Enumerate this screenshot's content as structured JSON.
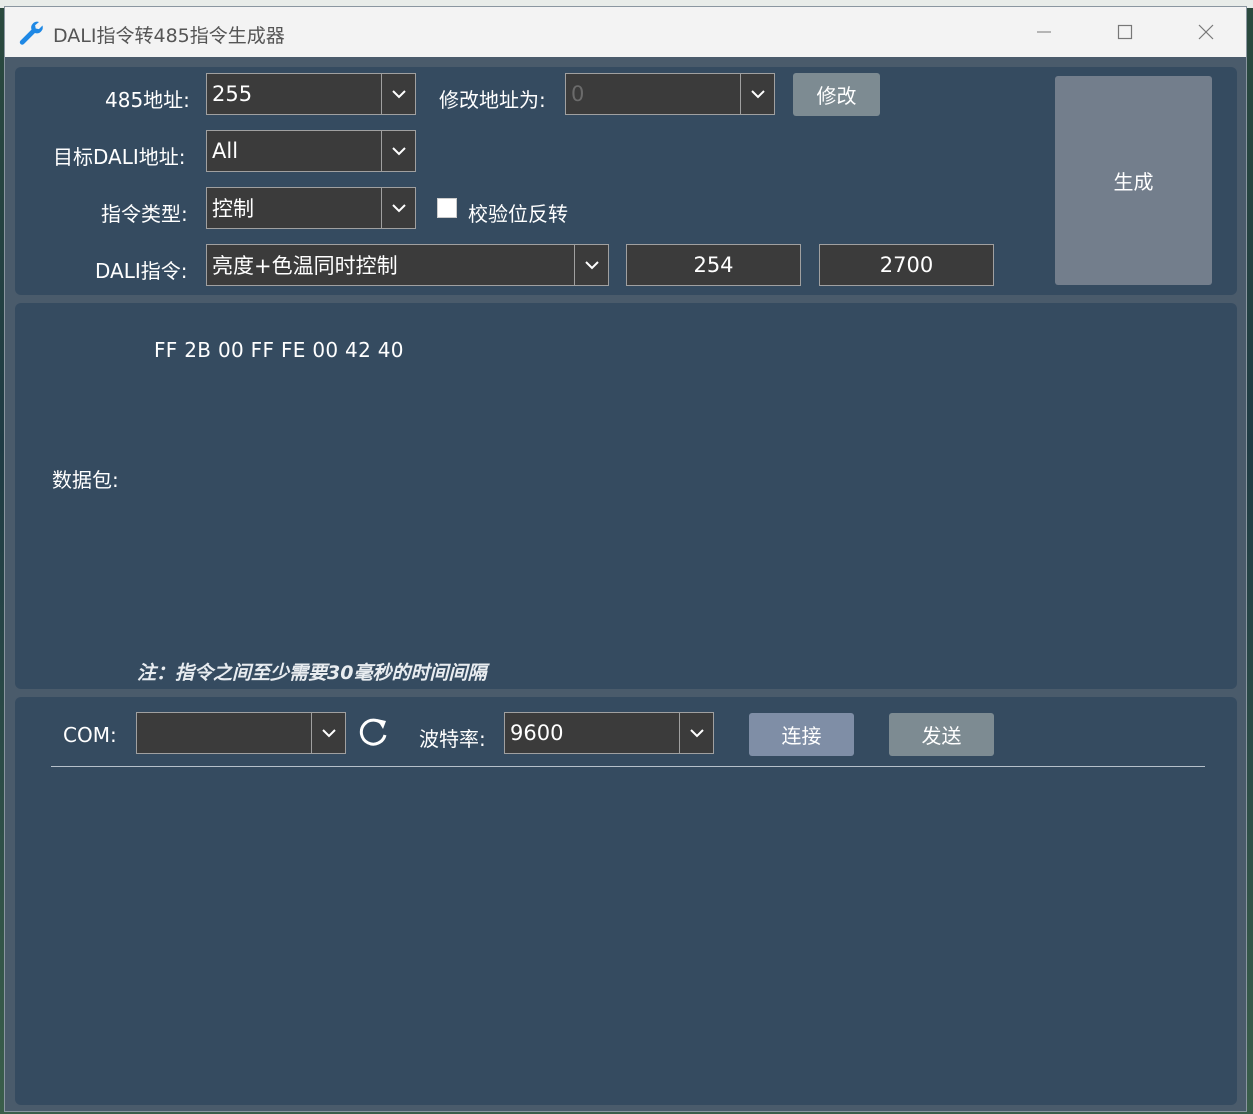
{
  "window": {
    "title": "DALI指令转485指令生成器",
    "controls": {
      "minimize": "—",
      "maximize": "☐",
      "close": "✕"
    },
    "icon": "wrench-icon"
  },
  "config": {
    "addr_label": "485地址:",
    "addr_value": "255",
    "modify_label": "修改地址为:",
    "modify_value": "0",
    "modify_button": "修改",
    "target_label": "目标DALI地址:",
    "target_value": "All",
    "type_label": "指令类型:",
    "type_value": "控制",
    "checksum_label": "校验位反转",
    "checksum_checked": false,
    "dali_label": "DALI指令:",
    "dali_value": "亮度+色温同时控制",
    "brightness": "254",
    "color_temp": "2700",
    "generate_button": "生成"
  },
  "packet": {
    "label": "数据包:",
    "hex": "FF 2B 00 FF FE 00 42 40",
    "note": "注：指令之间至少需要30毫秒的时间间隔"
  },
  "serial": {
    "com_label": "COM:",
    "com_value": "",
    "refresh_icon": "refresh-icon",
    "baud_label": "波特率:",
    "baud_value": "9600",
    "connect_button": "连接",
    "send_button": "发送"
  },
  "colors": {
    "panel": "#354b60",
    "window_bg": "#4a5b6b",
    "button": "#7d8b92",
    "button_blue": "#7f8ea6",
    "combo_bg": "#3b3b3b",
    "icon_blue": "#1e88e5"
  }
}
